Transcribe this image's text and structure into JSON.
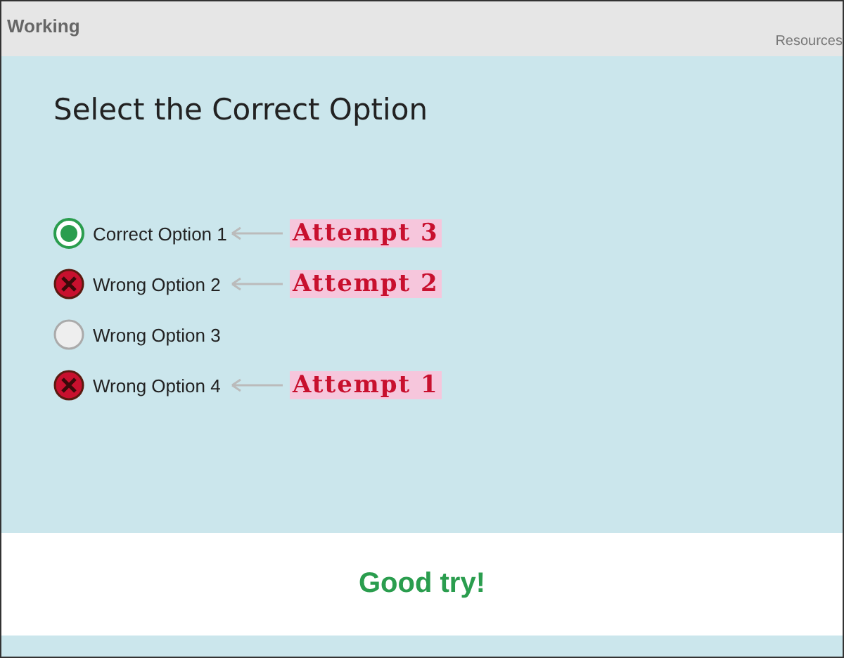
{
  "header": {
    "title": "Working",
    "link": "Resources"
  },
  "question": "Select the Correct Option",
  "options": [
    {
      "label": "Correct Option 1",
      "kind": "correct",
      "annotation": "Attempt 3"
    },
    {
      "label": "Wrong Option 2",
      "kind": "wrong",
      "annotation": "Attempt 2"
    },
    {
      "label": "Wrong Option 3",
      "kind": "none"
    },
    {
      "label": "Wrong Option 4",
      "kind": "wrong",
      "annotation": "Attempt 1"
    }
  ],
  "feedback": "Good try!"
}
